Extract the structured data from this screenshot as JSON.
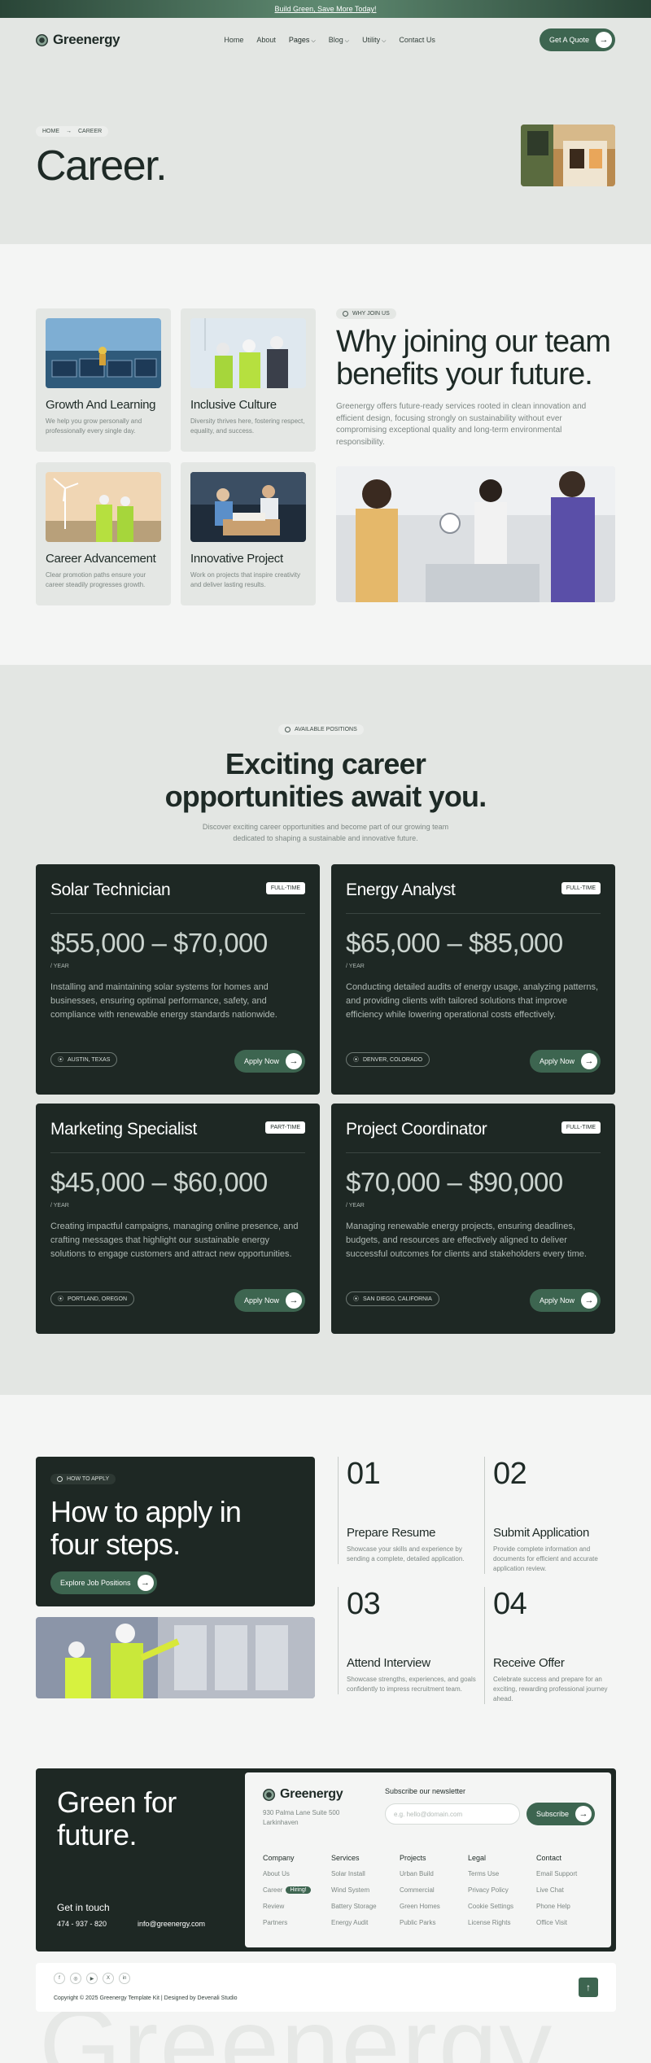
{
  "banner": {
    "text": "Build Green, Save More Today!"
  },
  "nav": {
    "brand": "Greenergy",
    "links": [
      "Home",
      "About",
      "Pages",
      "Blog",
      "Utility",
      "Contact Us"
    ],
    "cta": "Get A Quote"
  },
  "hero": {
    "crumb_home": "HOME",
    "crumb_current": "CAREER",
    "title": "Career."
  },
  "why": {
    "pill": "WHY JOIN US",
    "title_line1": "Why joining our team",
    "title_line2": "benefits your future.",
    "description": "Greenergy offers future-ready services rooted in clean innovation and efficient design, focusing strongly on sustainability without ever compromising exceptional quality and long-term environmental responsibility.",
    "cards": [
      {
        "title": "Growth And Learning",
        "text": "We help you grow personally and professionally every single day."
      },
      {
        "title": "Inclusive Culture",
        "text": "Diversity thrives here, fostering respect, equality, and success."
      },
      {
        "title": "Career Advancement",
        "text": "Clear promotion paths ensure your career steadily progresses growth."
      },
      {
        "title": "Innovative Project",
        "text": "Work on projects that inspire creativity and deliver lasting results."
      }
    ]
  },
  "positions": {
    "pill": "AVAILABLE POSITIONS",
    "title_line1": "Exciting career",
    "title_line2": "opportunities await you.",
    "description": "Discover exciting career opportunities and become part of our growing team dedicated to shaping a sustainable and innovative future.",
    "apply_label": "Apply Now",
    "per_label": "/ YEAR",
    "jobs": [
      {
        "title": "Solar Technician",
        "type": "FULL-TIME",
        "salary": "$55,000 – $70,000",
        "desc": "Installing and maintaining solar systems for homes and businesses, ensuring optimal performance, safety, and compliance with renewable energy standards nationwide.",
        "location": "AUSTIN, TEXAS"
      },
      {
        "title": "Energy Analyst",
        "type": "FULL-TIME",
        "salary": "$65,000 – $85,000",
        "desc": "Conducting detailed audits of energy usage, analyzing patterns, and providing clients with tailored solutions that improve efficiency while lowering operational costs effectively.",
        "location": "DENVER, COLORADO"
      },
      {
        "title": "Marketing Specialist",
        "type": "PART-TIME",
        "salary": "$45,000 – $60,000",
        "desc": "Creating impactful campaigns, managing online presence, and crafting messages that highlight our sustainable energy solutions to engage customers and attract new opportunities.",
        "location": "PORTLAND, OREGON"
      },
      {
        "title": "Project Coordinator",
        "type": "FULL-TIME",
        "salary": "$70,000 – $90,000",
        "desc": "Managing renewable energy projects, ensuring deadlines, budgets, and resources are effectively aligned to deliver successful outcomes for clients and stakeholders every time.",
        "location": "SAN DIEGO, CALIFORNIA"
      }
    ]
  },
  "howto": {
    "pill": "HOW TO APPLY",
    "title_line1": "How to apply in",
    "title_line2": "four steps.",
    "cta": "Explore Job Positions",
    "steps": [
      {
        "num": "01",
        "title": "Prepare Resume",
        "text": "Showcase your skills and experience by sending a complete, detailed application."
      },
      {
        "num": "02",
        "title": "Submit Application",
        "text": "Provide complete information and documents for efficient and accurate application review."
      },
      {
        "num": "03",
        "title": "Attend Interview",
        "text": "Showcase strengths, experiences, and goals confidently to impress recruitment team."
      },
      {
        "num": "04",
        "title": "Receive Offer",
        "text": "Celebrate success and prepare for an exciting, rewarding professional journey ahead."
      }
    ]
  },
  "footer": {
    "title_line1": "Green for",
    "title_line2": "future.",
    "get_in_touch": "Get in touch",
    "phone": "474 - 937 - 820",
    "email": "info@greenergy.com",
    "brand": "Greenergy",
    "address": "930 Palma Lane Suite 500 Larkinhaven",
    "newsletter_label": "Subscribe our newsletter",
    "newsletter_placeholder": "e.g. hello@domain.com",
    "subscribe": "Subscribe",
    "hiring": "Hiring!",
    "columns": [
      {
        "title": "Company",
        "items": [
          "About Us",
          "Career",
          "Review",
          "Partners"
        ]
      },
      {
        "title": "Services",
        "items": [
          "Solar Install",
          "Wind System",
          "Battery Storage",
          "Energy Audit"
        ]
      },
      {
        "title": "Projects",
        "items": [
          "Urban Build",
          "Commercial",
          "Green Homes",
          "Public Parks"
        ]
      },
      {
        "title": "Legal",
        "items": [
          "Terms Use",
          "Privacy Policy",
          "Cookie Settings",
          "License Rights"
        ]
      },
      {
        "title": "Contact",
        "items": [
          "Email Support",
          "Live Chat",
          "Phone Help",
          "Office Visit"
        ]
      }
    ],
    "socials": [
      "f",
      "◎",
      "▶",
      "X",
      "in"
    ],
    "copyright": "Copyright © 2025 Greenergy Template Kit | Designed by Devenali Studio",
    "watermark": "Greenergy"
  }
}
